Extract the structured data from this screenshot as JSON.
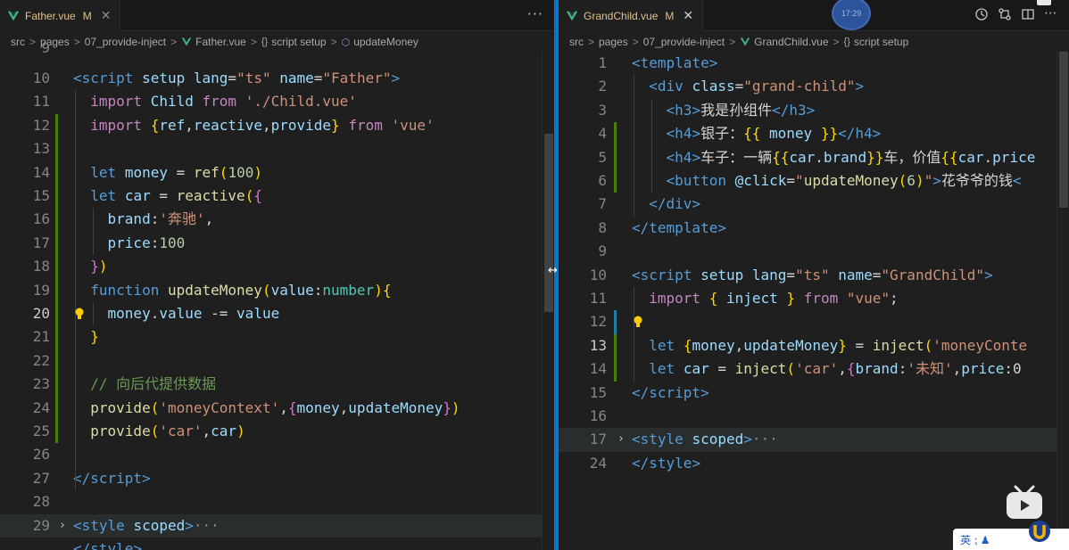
{
  "left": {
    "tab": {
      "name": "Father.vue",
      "status": "M"
    },
    "more": "···",
    "breadcrumb": [
      {
        "text": "src"
      },
      {
        "text": "pages"
      },
      {
        "text": "07_provide-inject"
      },
      {
        "text": "Father.vue",
        "icon": "vue-icon"
      },
      {
        "text": "script setup",
        "icon": "braces-icon",
        "glyph": "{}"
      },
      {
        "text": "updateMoney",
        "icon": "method-icon",
        "glyph": "⬡"
      }
    ],
    "partial_top_line": "9",
    "lines": [
      {
        "n": "10",
        "t": [
          [
            "tag",
            "<"
          ],
          [
            "tag",
            "script"
          ],
          [
            "txt",
            " "
          ],
          [
            "attr",
            "setup"
          ],
          [
            "txt",
            " "
          ],
          [
            "attr",
            "lang"
          ],
          [
            "txt",
            "="
          ],
          [
            "str",
            "\"ts\""
          ],
          [
            "txt",
            " "
          ],
          [
            "attr",
            "name"
          ],
          [
            "txt",
            "="
          ],
          [
            "str",
            "\"Father\""
          ],
          [
            "tag",
            ">"
          ]
        ]
      },
      {
        "n": "11",
        "t": [
          [
            "txt",
            "  "
          ],
          [
            "ctl",
            "import"
          ],
          [
            "txt",
            " "
          ],
          [
            "var",
            "Child"
          ],
          [
            "txt",
            " "
          ],
          [
            "ctl",
            "from"
          ],
          [
            "txt",
            " "
          ],
          [
            "str",
            "'./Child.vue'"
          ]
        ]
      },
      {
        "n": "12",
        "t": [
          [
            "txt",
            "  "
          ],
          [
            "ctl",
            "import"
          ],
          [
            "txt",
            " "
          ],
          [
            "br1",
            "{"
          ],
          [
            "var",
            "ref"
          ],
          [
            "txt",
            ","
          ],
          [
            "var",
            "reactive"
          ],
          [
            "txt",
            ","
          ],
          [
            "var",
            "provide"
          ],
          [
            "br1",
            "}"
          ],
          [
            "txt",
            " "
          ],
          [
            "ctl",
            "from"
          ],
          [
            "txt",
            " "
          ],
          [
            "str",
            "'vue'"
          ]
        ]
      },
      {
        "n": "13",
        "t": []
      },
      {
        "n": "14",
        "t": [
          [
            "txt",
            "  "
          ],
          [
            "kw",
            "let"
          ],
          [
            "txt",
            " "
          ],
          [
            "var",
            "money"
          ],
          [
            "txt",
            " = "
          ],
          [
            "fn",
            "ref"
          ],
          [
            "br1",
            "("
          ],
          [
            "num",
            "100"
          ],
          [
            "br1",
            ")"
          ]
        ]
      },
      {
        "n": "15",
        "t": [
          [
            "txt",
            "  "
          ],
          [
            "kw",
            "let"
          ],
          [
            "txt",
            " "
          ],
          [
            "var",
            "car"
          ],
          [
            "txt",
            " = "
          ],
          [
            "fn",
            "reactive"
          ],
          [
            "br1",
            "("
          ],
          [
            "br2",
            "{"
          ]
        ]
      },
      {
        "n": "16",
        "t": [
          [
            "txt",
            "    "
          ],
          [
            "var",
            "brand"
          ],
          [
            "txt",
            ":"
          ],
          [
            "str",
            "'奔驰'"
          ],
          [
            "txt",
            ","
          ]
        ]
      },
      {
        "n": "17",
        "t": [
          [
            "txt",
            "    "
          ],
          [
            "var",
            "price"
          ],
          [
            "txt",
            ":"
          ],
          [
            "num",
            "100"
          ]
        ]
      },
      {
        "n": "18",
        "t": [
          [
            "txt",
            "  "
          ],
          [
            "br2",
            "}"
          ],
          [
            "br1",
            ")"
          ]
        ]
      },
      {
        "n": "19",
        "t": [
          [
            "txt",
            "  "
          ],
          [
            "kw",
            "function"
          ],
          [
            "txt",
            " "
          ],
          [
            "fn",
            "updateMoney"
          ],
          [
            "br1",
            "("
          ],
          [
            "var",
            "value"
          ],
          [
            "txt",
            ":"
          ],
          [
            "ty",
            "number"
          ],
          [
            "br1",
            ")"
          ],
          [
            "br1",
            "{"
          ]
        ]
      },
      {
        "n": "20",
        "t": [
          [
            "txt",
            "    "
          ],
          [
            "var",
            "money"
          ],
          [
            "txt",
            "."
          ],
          [
            "var",
            "value"
          ],
          [
            "txt",
            " -= "
          ],
          [
            "var",
            "value"
          ]
        ],
        "current": true
      },
      {
        "n": "21",
        "t": [
          [
            "txt",
            "  "
          ],
          [
            "br1",
            "}"
          ]
        ]
      },
      {
        "n": "22",
        "t": []
      },
      {
        "n": "23",
        "t": [
          [
            "txt",
            "  "
          ],
          [
            "com",
            "// 向后代提供数据"
          ]
        ]
      },
      {
        "n": "24",
        "t": [
          [
            "txt",
            "  "
          ],
          [
            "fn",
            "provide"
          ],
          [
            "br1",
            "("
          ],
          [
            "str",
            "'moneyContext'"
          ],
          [
            "txt",
            ","
          ],
          [
            "br2",
            "{"
          ],
          [
            "var",
            "money"
          ],
          [
            "txt",
            ","
          ],
          [
            "var",
            "updateMoney"
          ],
          [
            "br2",
            "}"
          ],
          [
            "br1",
            ")"
          ]
        ]
      },
      {
        "n": "25",
        "t": [
          [
            "txt",
            "  "
          ],
          [
            "fn",
            "provide"
          ],
          [
            "br1",
            "("
          ],
          [
            "str",
            "'car'"
          ],
          [
            "txt",
            ","
          ],
          [
            "var",
            "car"
          ],
          [
            "br1",
            ")"
          ]
        ]
      },
      {
        "n": "26",
        "t": []
      },
      {
        "n": "27",
        "t": [
          [
            "tag",
            "</"
          ],
          [
            "tag",
            "script"
          ],
          [
            "tag",
            ">"
          ]
        ]
      },
      {
        "n": "28",
        "t": []
      },
      {
        "n": "29",
        "t": [
          [
            "tag",
            "<"
          ],
          [
            "tag",
            "style"
          ],
          [
            "txt",
            " "
          ],
          [
            "attr",
            "scoped"
          ],
          [
            "tag",
            ">"
          ],
          [
            "dots",
            "···"
          ]
        ],
        "folded": true
      },
      {
        "n": "",
        "t": [
          [
            "tag",
            "</"
          ],
          [
            "tag",
            "style"
          ],
          [
            "tag",
            ">"
          ]
        ],
        "partial": true
      }
    ]
  },
  "right": {
    "tab": {
      "name": "GrandChild.vue",
      "status": "M"
    },
    "breadcrumb": [
      {
        "text": "src"
      },
      {
        "text": "pages"
      },
      {
        "text": "07_provide-inject"
      },
      {
        "text": "GrandChild.vue",
        "icon": "vue-icon"
      },
      {
        "text": "script setup",
        "icon": "braces-icon",
        "glyph": "{}"
      }
    ],
    "lines": [
      {
        "n": "1",
        "t": [
          [
            "tag",
            "<"
          ],
          [
            "tag",
            "template"
          ],
          [
            "tag",
            ">"
          ]
        ]
      },
      {
        "n": "2",
        "t": [
          [
            "txt",
            "  "
          ],
          [
            "tag",
            "<"
          ],
          [
            "tag",
            "div"
          ],
          [
            "txt",
            " "
          ],
          [
            "attr",
            "class"
          ],
          [
            "txt",
            "="
          ],
          [
            "str",
            "\"grand-child\""
          ],
          [
            "tag",
            ">"
          ]
        ]
      },
      {
        "n": "3",
        "t": [
          [
            "txt",
            "    "
          ],
          [
            "tag",
            "<"
          ],
          [
            "tag",
            "h3"
          ],
          [
            "tag",
            ">"
          ],
          [
            "txt",
            "我是孙组件"
          ],
          [
            "tag",
            "</"
          ],
          [
            "tag",
            "h3"
          ],
          [
            "tag",
            ">"
          ]
        ]
      },
      {
        "n": "4",
        "t": [
          [
            "txt",
            "    "
          ],
          [
            "tag",
            "<"
          ],
          [
            "tag",
            "h4"
          ],
          [
            "tag",
            ">"
          ],
          [
            "txt",
            "银子："
          ],
          [
            "br1",
            "{{"
          ],
          [
            "txt",
            " "
          ],
          [
            "var",
            "money"
          ],
          [
            "txt",
            " "
          ],
          [
            "br1",
            "}}"
          ],
          [
            "tag",
            "</"
          ],
          [
            "tag",
            "h4"
          ],
          [
            "tag",
            ">"
          ]
        ]
      },
      {
        "n": "5",
        "t": [
          [
            "txt",
            "    "
          ],
          [
            "tag",
            "<"
          ],
          [
            "tag",
            "h4"
          ],
          [
            "tag",
            ">"
          ],
          [
            "txt",
            "车子：一辆"
          ],
          [
            "br1",
            "{{"
          ],
          [
            "var",
            "car"
          ],
          [
            "txt",
            "."
          ],
          [
            "var",
            "brand"
          ],
          [
            "br1",
            "}}"
          ],
          [
            "txt",
            "车，价值"
          ],
          [
            "br1",
            "{{"
          ],
          [
            "var",
            "car"
          ],
          [
            "txt",
            "."
          ],
          [
            "var",
            "price"
          ]
        ]
      },
      {
        "n": "6",
        "t": [
          [
            "txt",
            "    "
          ],
          [
            "tag",
            "<"
          ],
          [
            "tag",
            "button"
          ],
          [
            "txt",
            " "
          ],
          [
            "attr",
            "@click"
          ],
          [
            "txt",
            "="
          ],
          [
            "str",
            "\""
          ],
          [
            "fn",
            "updateMoney"
          ],
          [
            "br1",
            "("
          ],
          [
            "num",
            "6"
          ],
          [
            "br1",
            ")"
          ],
          [
            "str",
            "\""
          ],
          [
            "tag",
            ">"
          ],
          [
            "txt",
            "花爷爷的钱"
          ],
          [
            "tag",
            "<"
          ]
        ]
      },
      {
        "n": "7",
        "t": [
          [
            "txt",
            "  "
          ],
          [
            "tag",
            "</"
          ],
          [
            "tag",
            "div"
          ],
          [
            "tag",
            ">"
          ]
        ]
      },
      {
        "n": "8",
        "t": [
          [
            "tag",
            "</"
          ],
          [
            "tag",
            "template"
          ],
          [
            "tag",
            ">"
          ]
        ]
      },
      {
        "n": "9",
        "t": []
      },
      {
        "n": "10",
        "t": [
          [
            "tag",
            "<"
          ],
          [
            "tag",
            "script"
          ],
          [
            "txt",
            " "
          ],
          [
            "attr",
            "setup"
          ],
          [
            "txt",
            " "
          ],
          [
            "attr",
            "lang"
          ],
          [
            "txt",
            "="
          ],
          [
            "str",
            "\"ts\""
          ],
          [
            "txt",
            " "
          ],
          [
            "attr",
            "name"
          ],
          [
            "txt",
            "="
          ],
          [
            "str",
            "\"GrandChild\""
          ],
          [
            "tag",
            ">"
          ]
        ]
      },
      {
        "n": "11",
        "t": [
          [
            "txt",
            "  "
          ],
          [
            "ctl",
            "import"
          ],
          [
            "txt",
            " "
          ],
          [
            "br1",
            "{"
          ],
          [
            "txt",
            " "
          ],
          [
            "var",
            "inject"
          ],
          [
            "txt",
            " "
          ],
          [
            "br1",
            "}"
          ],
          [
            "txt",
            " "
          ],
          [
            "ctl",
            "from"
          ],
          [
            "txt",
            " "
          ],
          [
            "str",
            "\"vue\""
          ],
          [
            "txt",
            ";"
          ]
        ]
      },
      {
        "n": "12",
        "t": []
      },
      {
        "n": "13",
        "t": [
          [
            "txt",
            "  "
          ],
          [
            "kw",
            "let"
          ],
          [
            "txt",
            " "
          ],
          [
            "br1",
            "{"
          ],
          [
            "var",
            "money"
          ],
          [
            "txt",
            ","
          ],
          [
            "var",
            "updateMoney"
          ],
          [
            "br1",
            "}"
          ],
          [
            "txt",
            " = "
          ],
          [
            "fn",
            "inject"
          ],
          [
            "br1",
            "("
          ],
          [
            "str",
            "'moneyConte"
          ]
        ],
        "current": true
      },
      {
        "n": "14",
        "t": [
          [
            "txt",
            "  "
          ],
          [
            "kw",
            "let"
          ],
          [
            "txt",
            " "
          ],
          [
            "var",
            "car"
          ],
          [
            "txt",
            " = "
          ],
          [
            "fn",
            "inject"
          ],
          [
            "br1",
            "("
          ],
          [
            "str",
            "'car'"
          ],
          [
            "txt",
            ","
          ],
          [
            "br2",
            "{"
          ],
          [
            "var",
            "brand"
          ],
          [
            "txt",
            ":"
          ],
          [
            "str",
            "'未知'"
          ],
          [
            "txt",
            ","
          ],
          [
            "var",
            "price"
          ],
          [
            "txt",
            ":0"
          ]
        ]
      },
      {
        "n": "15",
        "t": [
          [
            "tag",
            "</"
          ],
          [
            "tag",
            "script"
          ],
          [
            "tag",
            ">"
          ]
        ]
      },
      {
        "n": "16",
        "t": []
      },
      {
        "n": "17",
        "t": [
          [
            "tag",
            "<"
          ],
          [
            "tag",
            "style"
          ],
          [
            "txt",
            " "
          ],
          [
            "attr",
            "scoped"
          ],
          [
            "tag",
            ">"
          ],
          [
            "dots",
            "···"
          ]
        ],
        "folded": true
      },
      {
        "n": "24",
        "t": [
          [
            "tag",
            "</"
          ],
          [
            "tag",
            "style"
          ],
          [
            "tag",
            ">"
          ]
        ]
      }
    ]
  },
  "overlays": {
    "time": "17:29",
    "ime_text": "英 ⁏ ♟"
  }
}
